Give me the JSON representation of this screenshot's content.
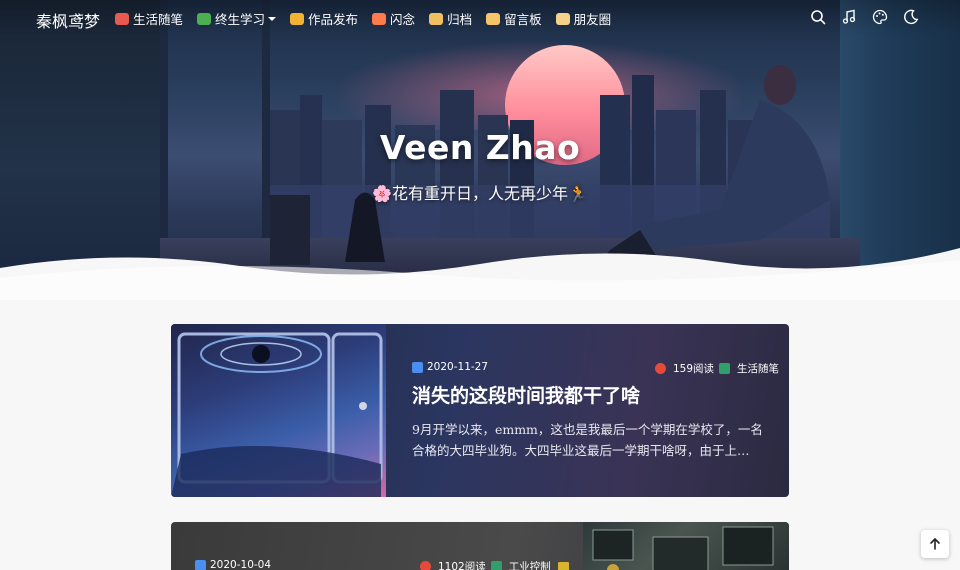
{
  "nav": {
    "brand": "秦枫鸢梦",
    "items": [
      {
        "label": "生活随笔",
        "emoji_color": "#e85a4f"
      },
      {
        "label": "终生学习",
        "emoji_color": "#4caf50",
        "has_dropdown": true
      },
      {
        "label": "作品发布",
        "emoji_color": "#f2b233"
      },
      {
        "label": "闪念",
        "emoji_color": "#ff7a4d"
      },
      {
        "label": "归档",
        "emoji_color": "#f0c060"
      },
      {
        "label": "留言板",
        "emoji_color": "#f6c56a"
      },
      {
        "label": "朋友圈",
        "emoji_color": "#f5d28a"
      }
    ],
    "icons": [
      "search-icon",
      "music-icon",
      "palette-icon",
      "moon-icon"
    ]
  },
  "hero": {
    "title": "Veen Zhao",
    "subtitle": "🌸花有重开日，人无再少年🏃"
  },
  "posts": [
    {
      "date": "2020-11-27",
      "views": "159阅读",
      "category": "生活随笔",
      "title": "消失的这段时间我都干了啥",
      "excerpt": "9月开学以来，emmm，这也是我最后一个学期在学校了，一名合格的大四毕业狗。大四毕业这最后一学期干啥呀，由于上…"
    },
    {
      "date": "2020-10-04",
      "views": "1102阅读",
      "category": "工业控制"
    }
  ],
  "colors": {
    "accent_blue": "#4a8ff0",
    "fire_red": "#e84a3a",
    "tag_green": "#2fa06a"
  }
}
